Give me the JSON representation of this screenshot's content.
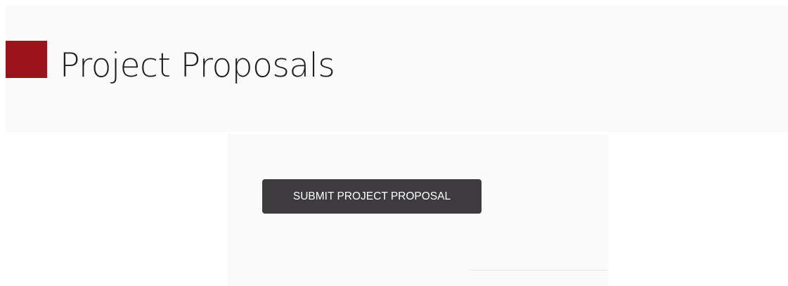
{
  "header": {
    "title": "Project Proposals",
    "accent_color": "#9b141c"
  },
  "panel": {
    "submit_button_label": "SUBMIT PROJECT PROPOSAL"
  }
}
